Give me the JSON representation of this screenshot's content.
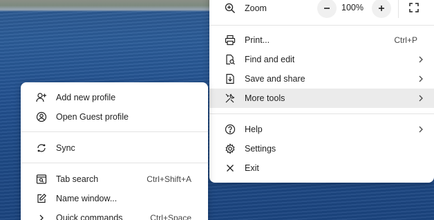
{
  "main_menu": {
    "zoom": {
      "label": "Zoom",
      "value": "100%",
      "decrease_icon": "minus-icon",
      "increase_icon": "plus-icon",
      "fullscreen_icon": "fullscreen-icon"
    },
    "items": [
      {
        "label": "Print...",
        "shortcut": "Ctrl+P",
        "icon": "printer-icon"
      },
      {
        "label": "Find and edit",
        "icon": "find-icon"
      },
      {
        "label": "Save and share",
        "icon": "save-icon"
      },
      {
        "label": "More tools",
        "icon": "tools-icon"
      },
      {
        "label": "Help",
        "icon": "help-icon"
      },
      {
        "label": "Settings",
        "icon": "gear-icon"
      },
      {
        "label": "Exit",
        "icon": "close-icon"
      }
    ]
  },
  "profile_menu": {
    "items": [
      {
        "label": "Add new profile",
        "icon": "add-person-icon"
      },
      {
        "label": "Open Guest profile",
        "icon": "guest-profile-icon"
      },
      {
        "label": "Sync",
        "icon": "sync-icon"
      },
      {
        "label": "Tab search",
        "shortcut": "Ctrl+Shift+A",
        "icon": "tab-search-icon"
      },
      {
        "label": "Name window...",
        "icon": "pencil-icon"
      },
      {
        "label": "Quick commands",
        "shortcut": "Ctrl+Space",
        "icon": "chevron-right-icon"
      }
    ]
  },
  "colors": {
    "highlight": "#ebebeb",
    "menu_bg": "#ffffff",
    "text": "#1f1f1f"
  }
}
